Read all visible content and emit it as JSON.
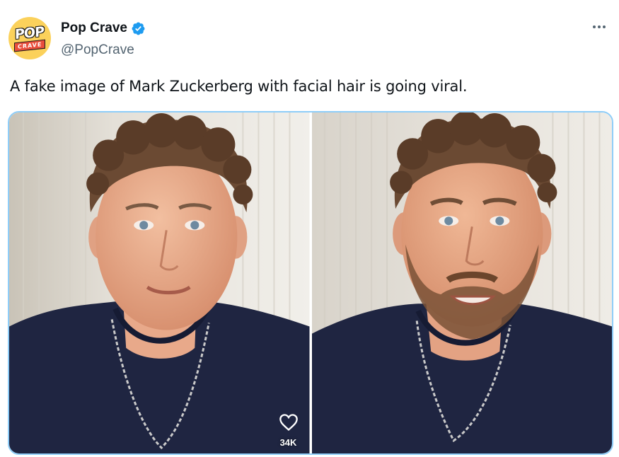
{
  "author": {
    "display_name": "Pop Crave",
    "handle": "@PopCrave",
    "verified": true,
    "avatar": {
      "logo_text_top": "POP",
      "logo_text_bottom": "CRAVE",
      "colors": [
        "#fbd15b",
        "#f39a39",
        "#e94e3c"
      ]
    }
  },
  "tweet": {
    "text": "A fake image of Mark Zuckerberg with facial hair is going viral."
  },
  "media": {
    "count": 2,
    "border_color": "#8ecdf8",
    "images": [
      {
        "subject": "man with curly hair, clean shaven, navy shirt, silver chain",
        "icon": "photo"
      },
      {
        "subject": "man with curly hair and beard, navy shirt, silver chain",
        "icon": "photo"
      }
    ],
    "overlay": {
      "icon": "heart-icon",
      "like_count": "34K"
    }
  },
  "icons": {
    "verified": "verified-badge-icon",
    "more": "more-icon"
  },
  "colors": {
    "text_primary": "#0f1419",
    "text_secondary": "#536471",
    "verified_blue": "#1d9bf0"
  }
}
